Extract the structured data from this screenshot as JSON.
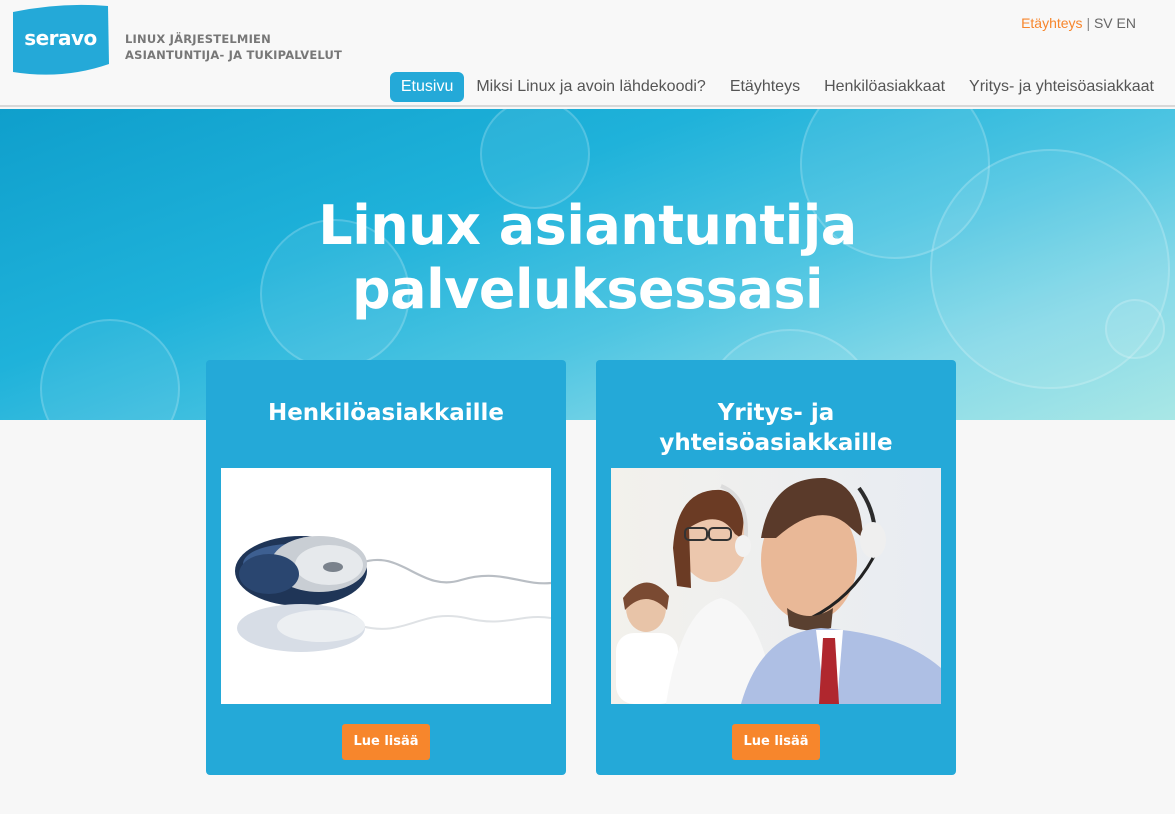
{
  "brand": {
    "logo_text": "seravo",
    "tagline_line1": "LINUX JÄRJESTELMIEN",
    "tagline_line2": "ASIANTUNTIJA- JA TUKIPALVELUT",
    "color": "#24a9d8"
  },
  "toplinks": {
    "contact": "Etäyhteys",
    "separator": "|",
    "lang_sv": "SV",
    "lang_en": "EN"
  },
  "nav": {
    "items": [
      {
        "label": "Etusivu",
        "active": true
      },
      {
        "label": "Miksi Linux ja avoin lähdekoodi?",
        "active": false
      },
      {
        "label": "Etäyhteys",
        "active": false
      },
      {
        "label": "Henkilöasiakkaat",
        "active": false
      },
      {
        "label": "Yritys- ja yhteisöasiakkaat",
        "active": false
      }
    ]
  },
  "hero": {
    "title_line1": "Linux asiantuntija",
    "title_line2": "palveluksessasi"
  },
  "cards": [
    {
      "title": "Henkilöasiakkaille",
      "image": "computer-mouse-photo",
      "button": "Lue lisää"
    },
    {
      "title": "Yritys- ja yhteisöasiakkaille",
      "image": "support-agents-headsets-photo",
      "button": "Lue lisää"
    }
  ],
  "colors": {
    "accent_blue": "#24a9d8",
    "accent_orange": "#f7862c"
  }
}
